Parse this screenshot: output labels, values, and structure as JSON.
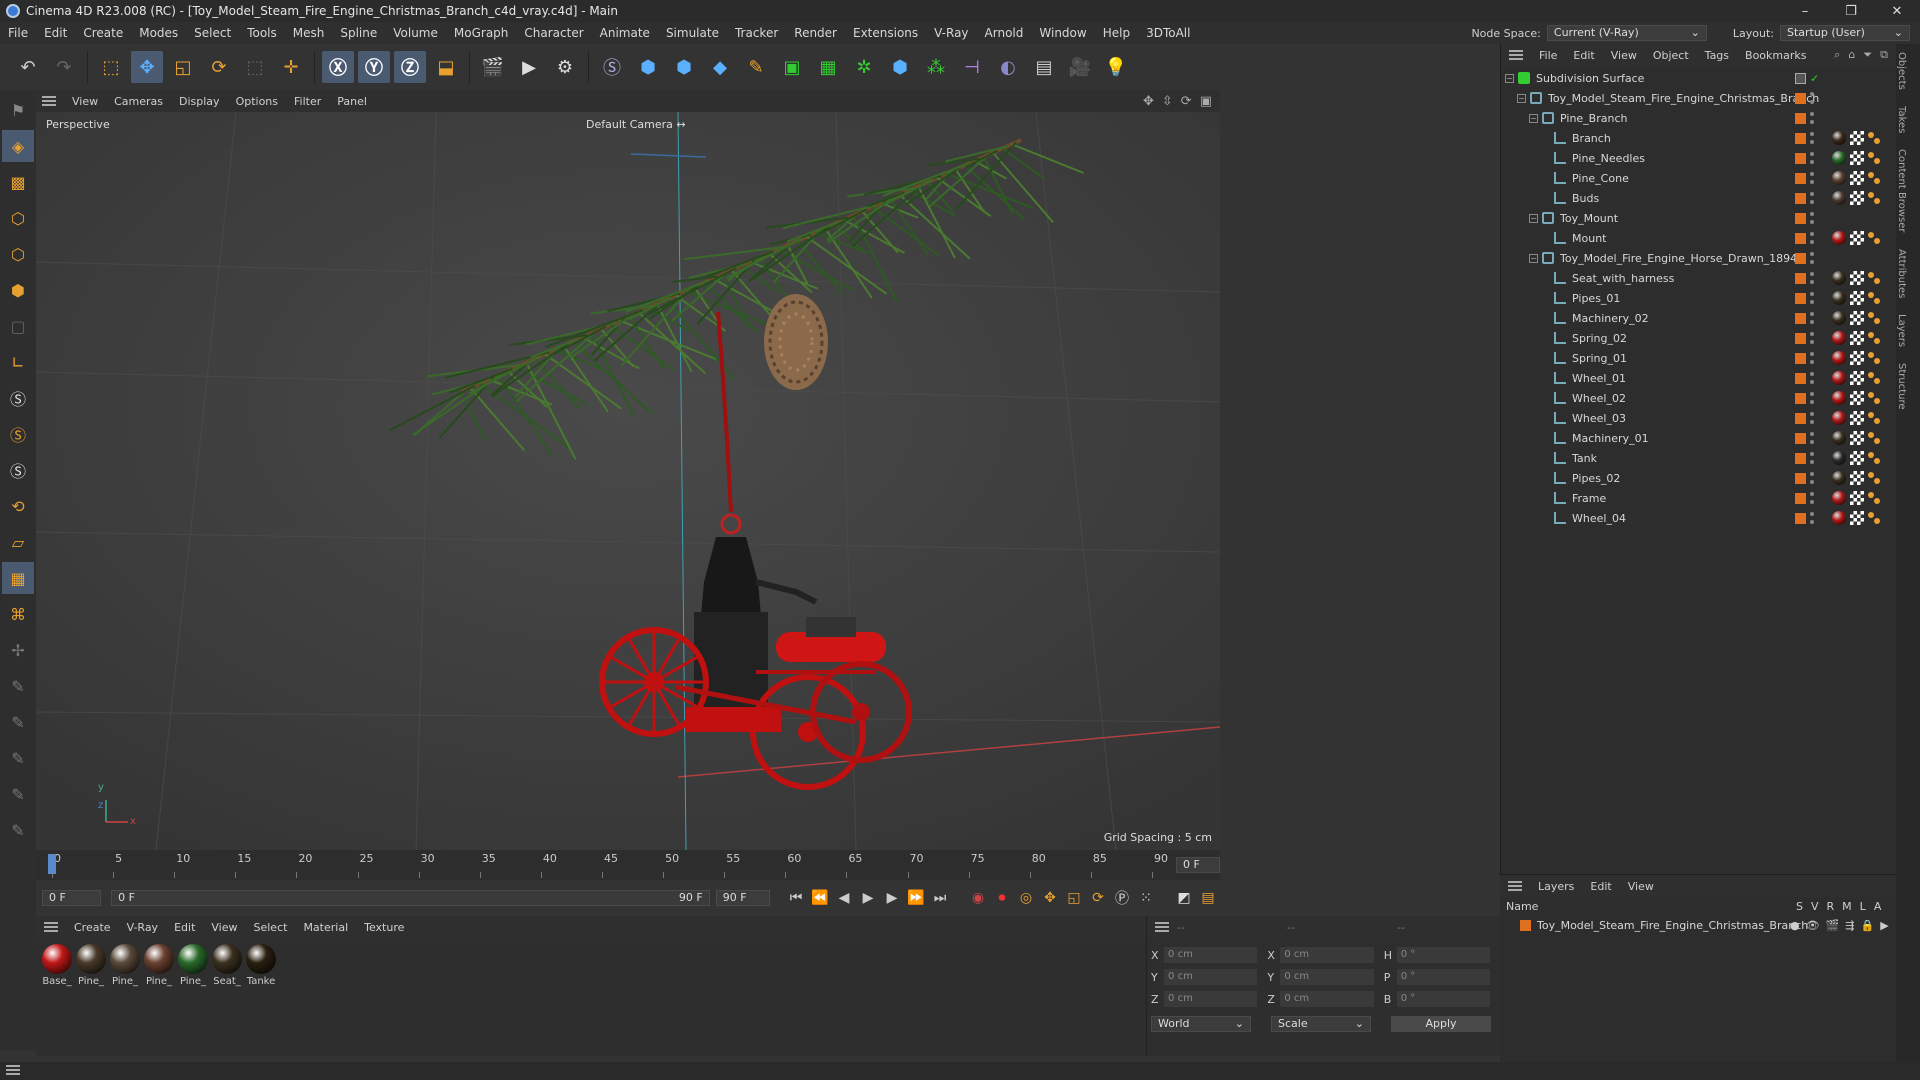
{
  "window": {
    "title": "Cinema 4D R23.008 (RC) - [Toy_Model_Steam_Fire_Engine_Christmas_Branch_c4d_vray.c4d] - Main",
    "controls": [
      "–",
      "❐",
      "✕"
    ]
  },
  "menubar": {
    "items": [
      "File",
      "Edit",
      "Create",
      "Modes",
      "Select",
      "Tools",
      "Mesh",
      "Spline",
      "Volume",
      "MoGraph",
      "Character",
      "Animate",
      "Simulate",
      "Tracker",
      "Render",
      "Extensions",
      "V-Ray",
      "Arnold",
      "Window",
      "Help",
      "3DToAll"
    ],
    "node_space_label": "Node Space:",
    "node_space_value": "Current (V-Ray)",
    "layout_label": "Layout:",
    "layout_value": "Startup (User)"
  },
  "viewport": {
    "menu": [
      "View",
      "Cameras",
      "Display",
      "Options",
      "Filter",
      "Panel"
    ],
    "view_name": "Perspective",
    "camera": "Default Camera",
    "grid_spacing": "Grid Spacing : 5 cm",
    "axis_y": "y",
    "axis_x": "x",
    "axis_z": "z"
  },
  "timeline": {
    "ticks": [
      "0",
      "5",
      "10",
      "15",
      "20",
      "25",
      "30",
      "35",
      "40",
      "45",
      "50",
      "55",
      "60",
      "65",
      "70",
      "75",
      "80",
      "85",
      "90"
    ],
    "current_frame_right": "0 F"
  },
  "transport": {
    "start_field": "0 F",
    "current_field": "0 F",
    "end_field": "90 F",
    "end_field2": "90 F"
  },
  "materials": {
    "menu": [
      "Create",
      "V-Ray",
      "Edit",
      "View",
      "Select",
      "Material",
      "Texture"
    ],
    "items": [
      {
        "name": "Base_",
        "color": "#c01818"
      },
      {
        "name": "Pine_",
        "color": "#4a3a2a"
      },
      {
        "name": "Pine_",
        "color": "#5a4a3a"
      },
      {
        "name": "Pine_",
        "color": "#6a4030"
      },
      {
        "name": "Pine_",
        "color": "#2a6a2a"
      },
      {
        "name": "Seat_",
        "color": "#3a3020"
      },
      {
        "name": "Tanke",
        "color": "#2a2010"
      }
    ]
  },
  "coords": {
    "rows": [
      {
        "a": "X",
        "v1": "0 cm",
        "b": "X",
        "v2": "0 cm",
        "c": "H",
        "v3": "0 °"
      },
      {
        "a": "Y",
        "v1": "0 cm",
        "b": "Y",
        "v2": "0 cm",
        "c": "P",
        "v3": "0 °"
      },
      {
        "a": "Z",
        "v1": "0 cm",
        "b": "Z",
        "v2": "0 cm",
        "c": "B",
        "v3": "0 °"
      }
    ],
    "header1": "--",
    "header2": "--",
    "header3": "--",
    "world": "World",
    "scale": "Scale",
    "apply": "Apply"
  },
  "objects": {
    "menu": [
      "File",
      "Edit",
      "View",
      "Object",
      "Tags",
      "Bookmarks"
    ],
    "tree": [
      {
        "name": "Subdivision Surface",
        "indent": 0,
        "type": "subd",
        "toggle": "−"
      },
      {
        "name": "Toy_Model_Steam_Fire_Engine_Christmas_Branch",
        "indent": 1,
        "type": "null",
        "toggle": "−"
      },
      {
        "name": "Pine_Branch",
        "indent": 2,
        "type": "null",
        "toggle": "−"
      },
      {
        "name": "Branch",
        "indent": 3,
        "type": "obj",
        "mat": "#3a2a1a"
      },
      {
        "name": "Pine_Needles",
        "indent": 3,
        "type": "obj",
        "mat": "#2a6a2a"
      },
      {
        "name": "Pine_Cone",
        "indent": 3,
        "type": "obj",
        "mat": "#5a4030"
      },
      {
        "name": "Buds",
        "indent": 3,
        "type": "obj",
        "mat": "#4a3a30"
      },
      {
        "name": "Toy_Mount",
        "indent": 2,
        "type": "null",
        "toggle": "−"
      },
      {
        "name": "Mount",
        "indent": 3,
        "type": "obj",
        "mat": "#b01818"
      },
      {
        "name": "Toy_Model_Fire_Engine_Horse_Drawn_1894",
        "indent": 2,
        "type": "null",
        "toggle": "−"
      },
      {
        "name": "Seat_with_harness",
        "indent": 3,
        "type": "obj",
        "mat": "#3a3020"
      },
      {
        "name": "Pipes_01",
        "indent": 3,
        "type": "obj",
        "mat": "#3a3020"
      },
      {
        "name": "Machinery_02",
        "indent": 3,
        "type": "obj",
        "mat": "#3a3020"
      },
      {
        "name": "Spring_02",
        "indent": 3,
        "type": "obj",
        "mat": "#b01818"
      },
      {
        "name": "Spring_01",
        "indent": 3,
        "type": "obj",
        "mat": "#b01818"
      },
      {
        "name": "Wheel_01",
        "indent": 3,
        "type": "obj",
        "mat": "#b01818"
      },
      {
        "name": "Wheel_02",
        "indent": 3,
        "type": "obj",
        "mat": "#b01818"
      },
      {
        "name": "Wheel_03",
        "indent": 3,
        "type": "obj",
        "mat": "#b01818"
      },
      {
        "name": "Machinery_01",
        "indent": 3,
        "type": "obj",
        "mat": "#3a3020"
      },
      {
        "name": "Tank",
        "indent": 3,
        "type": "obj",
        "mat": "#2a2a2a"
      },
      {
        "name": "Pipes_02",
        "indent": 3,
        "type": "obj",
        "mat": "#3a3020"
      },
      {
        "name": "Frame",
        "indent": 3,
        "type": "obj",
        "mat": "#b01818"
      },
      {
        "name": "Wheel_04",
        "indent": 3,
        "type": "obj",
        "mat": "#b01818"
      }
    ]
  },
  "layers": {
    "menu": [
      "Layers",
      "Edit",
      "View"
    ],
    "col_name": "Name",
    "cols": [
      "S",
      "V",
      "R",
      "M",
      "L",
      "A"
    ],
    "rows": [
      {
        "name": "Toy_Model_Steam_Fire_Engine_Christmas_Branch",
        "color": "#e07020"
      }
    ]
  },
  "sidetabs": [
    "Objects",
    "Takes",
    "Content Browser",
    "Attributes",
    "Layers",
    "Structure"
  ]
}
